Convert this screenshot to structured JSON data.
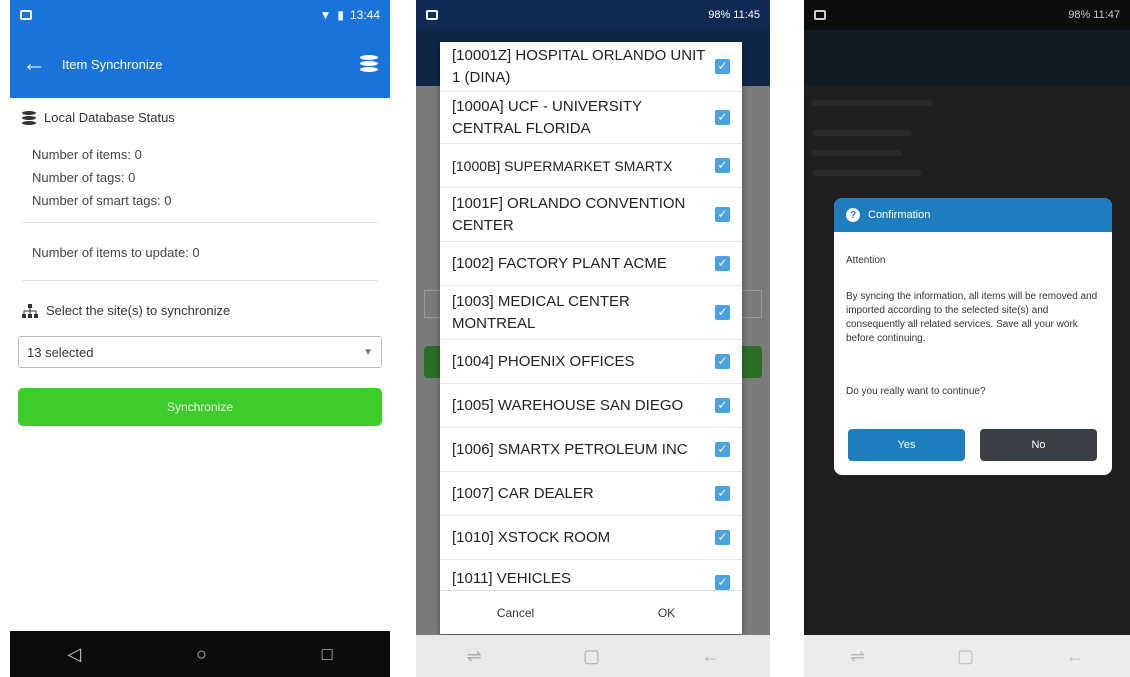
{
  "phone1": {
    "status_time": "13:44",
    "app_title": "Item Synchronize",
    "local_db": {
      "title": "Local Database Status",
      "items": "Number of items: 0",
      "tags": "Number of tags: 0",
      "smart_tags": "Number of smart tags: 0",
      "to_update": "Number of items to update: 0"
    },
    "select_sites_title": "Select the site(s) to synchronize",
    "select_value": "13 selected",
    "sync_button": "Synchronize",
    "nav": {
      "back": "◁",
      "home": "○",
      "recent": "□"
    }
  },
  "phone2": {
    "status_text": "98% 11:45",
    "sites": [
      "[10001Z] HOSPITAL ORLANDO UNIT 1 (DINA)",
      "[1000A] UCF - UNIVERSITY CENTRAL FLORIDA",
      "[1000B] SUPERMARKET SMARTX",
      "[1001F] ORLANDO CONVENTION CENTER",
      "[1002] FACTORY PLANT ACME",
      "[1003] MEDICAL CENTER MONTREAL",
      "[1004] PHOENIX OFFICES",
      "[1005] WAREHOUSE SAN DIEGO",
      "[1006] SMARTX PETROLEUM INC",
      "[1007] CAR DEALER",
      "[1010] XSTOCK ROOM",
      "[1011] VEHICLES"
    ],
    "cancel": "Cancel",
    "ok": "OK"
  },
  "phone3": {
    "status_text": "98% 11:47",
    "dialog_title": "Confirmation",
    "attention": "Attention",
    "message": "By syncing the information, all items will be removed and imported according to the selected site(s) and consequently all related services. Save all your work before continuing.",
    "question": "Do you really want to continue?",
    "yes": "Yes",
    "no": "No"
  },
  "colors": {
    "primary_blue": "#1a73d9",
    "sync_green": "#3dcc2a",
    "checkbox_blue": "#4aa3e0",
    "dialog_header": "#1e7dbf",
    "no_button": "#3a3f46"
  }
}
